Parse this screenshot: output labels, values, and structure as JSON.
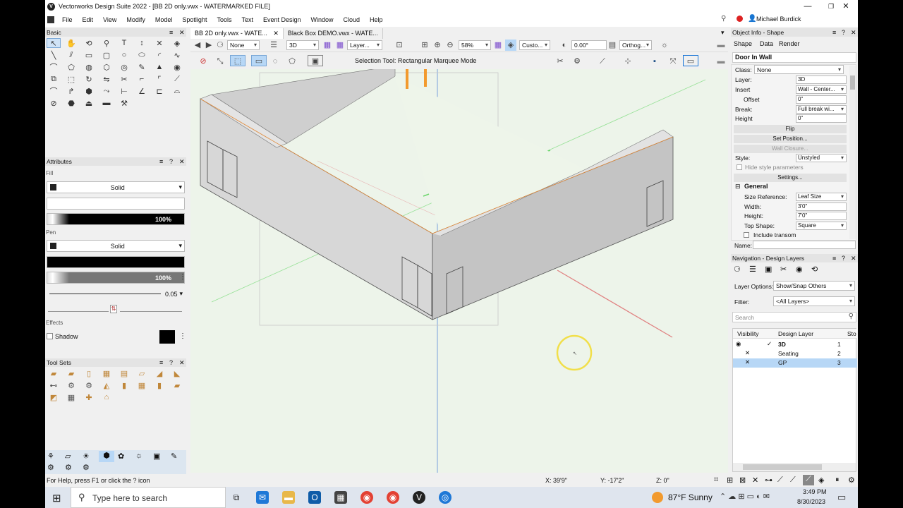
{
  "titlebar": {
    "title": "Vectorworks Design Suite 2022 - [BB 2D only.vwx - WATERMARKED FILE]",
    "minimize": "—",
    "restore": "❐",
    "close": "✕"
  },
  "menu": {
    "items": [
      "File",
      "Edit",
      "View",
      "Modify",
      "Model",
      "Spotlight",
      "Tools",
      "Text",
      "Event Design",
      "Window",
      "Cloud",
      "Help"
    ],
    "user": "Michael Burdick"
  },
  "basic_palette": {
    "title": "Basic"
  },
  "attributes": {
    "title": "Attributes",
    "fill_label": "Fill",
    "fill_style": "Solid",
    "fill_opacity": "100%",
    "pen_label": "Pen",
    "pen_style": "Solid",
    "pen_opacity": "100%",
    "line_weight": "0.05",
    "effects_label": "Effects",
    "shadow_label": "Shadow"
  },
  "tool_sets": {
    "title": "Tool Sets"
  },
  "tabs": [
    {
      "label": "BB 2D only.vwx - WATE..."
    },
    {
      "label": "Black Box DEMO.vwx - WATE..."
    }
  ],
  "viewbar": {
    "class": "None",
    "layer": "3D",
    "layer_options": "Layer...",
    "zoom": "58%",
    "view": "Custo...",
    "rotation": "0.00°",
    "projection": "Orthog..."
  },
  "modebar": {
    "mode_text": "Selection Tool: Rectangular Marquee Mode"
  },
  "object_info": {
    "title": "Object Info - Shape",
    "tabs": [
      "Shape",
      "Data",
      "Render"
    ],
    "object_name": "Door In Wall",
    "fields": [
      {
        "label": "Class:",
        "value": "None"
      },
      {
        "label": "Layer:",
        "value": "3D"
      },
      {
        "label": "Insert",
        "value": "Wall - Center..."
      },
      {
        "label": "Offset",
        "value": "0\""
      },
      {
        "label": "Break:",
        "value": "Full break wi..."
      },
      {
        "label": "Height",
        "value": "0\""
      }
    ],
    "buttons": [
      "Flip",
      "Set Position...",
      "Wall Closure...",
      "Settings..."
    ],
    "style_label": "Style:",
    "style_value": "Unstyled",
    "hide_style": "Hide style parameters",
    "general_title": "General",
    "general_fields": [
      {
        "label": "Size Reference:",
        "value": "Leaf Size"
      },
      {
        "label": "Width:",
        "value": "3'0\""
      },
      {
        "label": "Height:",
        "value": "7'0\""
      },
      {
        "label": "Top Shape:",
        "value": "Square"
      }
    ],
    "include_transom": "Include transom",
    "name_label": "Name:"
  },
  "navigation": {
    "title": "Navigation - Design Layers",
    "layer_options_label": "Layer Options:",
    "layer_options_value": "Show/Snap Others",
    "filter_label": "Filter:",
    "filter_value": "<All Layers>",
    "search_placeholder": "Search",
    "columns": [
      "Visibility",
      "Design Layer",
      "Sto"
    ],
    "layers": [
      {
        "name": "3D",
        "number": "1"
      },
      {
        "name": "Seating",
        "number": "2"
      },
      {
        "name": "GP",
        "number": "3"
      }
    ]
  },
  "status": {
    "help": "For Help, press F1 or click the ? icon",
    "x": "X: 39'9\"",
    "y": "Y: -17'2\"",
    "z": "Z: 0\""
  },
  "taskbar": {
    "search_placeholder": "Type here to search",
    "weather": "87°F Sunny",
    "time": "3:49 PM",
    "date": "8/30/2023"
  },
  "colors": {
    "accent": "#1e78d7",
    "selection_row": "#b7d7f6",
    "canvas": "#edf4ea",
    "wall_fill": "#d3d3d3"
  }
}
